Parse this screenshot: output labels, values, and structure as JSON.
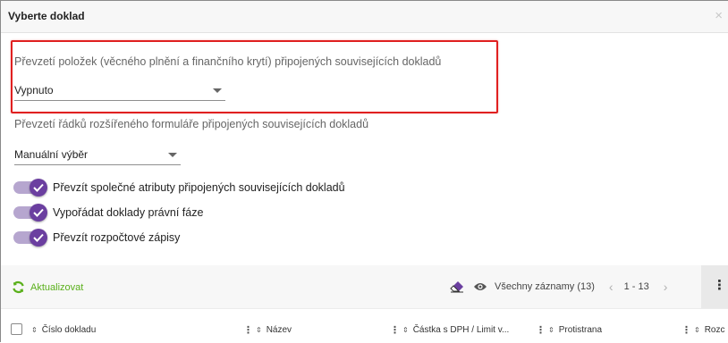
{
  "dialog": {
    "title": "Vyberte doklad",
    "close_glyph": "×"
  },
  "fields": {
    "items_label": "Převzetí položek (věcného plnění a finančního krytí) připojených souvisejících dokladů",
    "items_value": "Vypnuto",
    "rows_label": "Převzetí řádků rozšířeného formuláře připojených souvisejících dokladů",
    "rows_value": "Manuální výběr"
  },
  "toggles": [
    {
      "label": "Převzít společné atributy připojených souvisejících dokladů",
      "on": true
    },
    {
      "label": "Vypořádat doklady právní fáze",
      "on": true
    },
    {
      "label": "Převzít rozpočtové zápisy",
      "on": true
    }
  ],
  "toolbar": {
    "refresh_label": "Aktualizovat",
    "records_label": "Všechny záznamy (13)",
    "pager_prev": "‹",
    "pager_info": "1 - 13",
    "pager_next": "›",
    "more": "⋮"
  },
  "table": {
    "columns": [
      {
        "label": "Číslo dokladu"
      },
      {
        "label": "Název"
      },
      {
        "label": "Částka s DPH / Limit v..."
      },
      {
        "label": "Protistrana"
      },
      {
        "label": "Rozc"
      }
    ],
    "sort_glyph": "⇕",
    "menu_glyph": "⋮"
  },
  "colors": {
    "accent_purple": "#6b3fa0",
    "toggle_track": "#b6a6cf",
    "highlight_red": "#e02020",
    "refresh_green": "#5ab01b"
  },
  "icons": {
    "close": "close-icon",
    "dropdown": "chevron-down-icon",
    "toggle_check": "check-icon",
    "refresh": "refresh-icon",
    "eraser": "eraser-icon",
    "eye": "eye-icon",
    "more": "more-vertical-icon",
    "sort": "sort-icon"
  }
}
